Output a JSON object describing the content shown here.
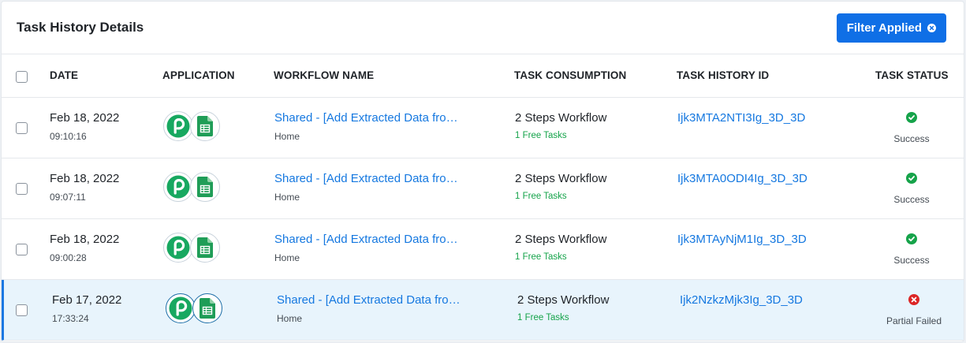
{
  "header": {
    "title": "Task History Details",
    "filter_button": "Filter Applied"
  },
  "columns": {
    "date": "DATE",
    "application": "APPLICATION",
    "workflow_name": "WORKFLOW NAME",
    "task_consumption": "TASK CONSUMPTION",
    "task_history_id": "TASK HISTORY ID",
    "task_status": "TASK STATUS"
  },
  "rows": [
    {
      "date": "Feb 18, 2022",
      "time": "09:10:16",
      "apps": [
        "pabbly-icon",
        "google-sheets-icon"
      ],
      "workflow": "Shared - [Add Extracted Data fro…",
      "folder": "Home",
      "consumption": "2 Steps Workflow",
      "tasks": "1 Free Tasks",
      "history_id": "Ijk3MTA2NTI3Ig_3D_3D",
      "status": "Success",
      "status_type": "success"
    },
    {
      "date": "Feb 18, 2022",
      "time": "09:07:11",
      "apps": [
        "pabbly-icon",
        "google-sheets-icon"
      ],
      "workflow": "Shared - [Add Extracted Data fro…",
      "folder": "Home",
      "consumption": "2 Steps Workflow",
      "tasks": "1 Free Tasks",
      "history_id": "Ijk3MTA0ODI4Ig_3D_3D",
      "status": "Success",
      "status_type": "success"
    },
    {
      "date": "Feb 18, 2022",
      "time": "09:00:28",
      "apps": [
        "pabbly-icon",
        "google-sheets-icon"
      ],
      "workflow": "Shared - [Add Extracted Data fro…",
      "folder": "Home",
      "consumption": "2 Steps Workflow",
      "tasks": "1 Free Tasks",
      "history_id": "Ijk3MTAyNjM1Ig_3D_3D",
      "status": "Success",
      "status_type": "success"
    },
    {
      "date": "Feb 17, 2022",
      "time": "17:33:24",
      "apps": [
        "pabbly-icon",
        "google-sheets-icon"
      ],
      "workflow": "Shared - [Add Extracted Data fro…",
      "folder": "Home",
      "consumption": "2 Steps Workflow",
      "tasks": "1 Free Tasks",
      "history_id": "Ijk2NzkzMjk3Ig_3D_3D",
      "status": "Partial Failed",
      "status_type": "failed",
      "selected": true
    }
  ],
  "colors": {
    "accent": "#0f6fe6",
    "link": "#1578e0",
    "success": "#16a34a",
    "failed": "#dc2626",
    "free_tasks": "#15a34a",
    "selected_row": "#e8f4fc"
  }
}
